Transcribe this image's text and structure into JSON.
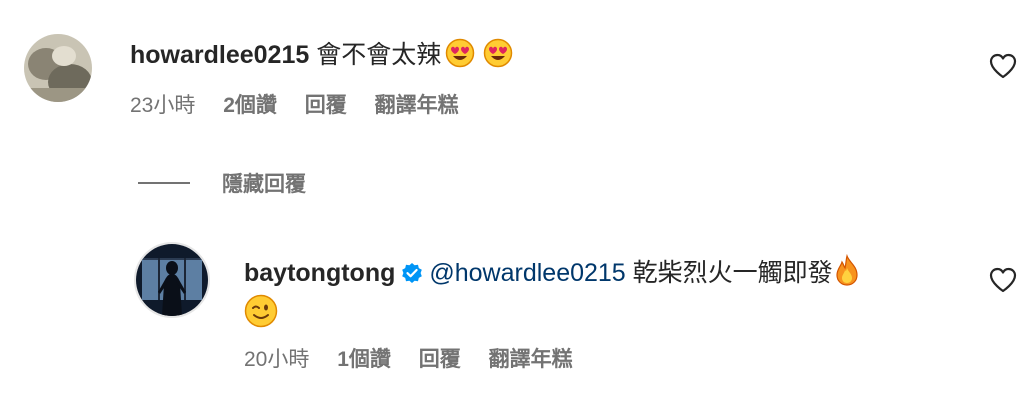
{
  "comments": [
    {
      "username": "howardlee0215",
      "text": "會不會太辣",
      "emojis": [
        "heart-eyes-emoji",
        "heart-eyes-emoji"
      ],
      "meta": {
        "time": "23小時",
        "likes": "2個讚",
        "reply": "回覆",
        "translate": "翻譯年糕"
      }
    }
  ],
  "hide_replies": "隱藏回覆",
  "reply": {
    "username": "baytongtong",
    "verified": true,
    "mention": "@howardlee0215",
    "text": "乾柴烈火一觸即發",
    "emojis": [
      "fire-emoji",
      "winking-face-emoji"
    ],
    "meta": {
      "time": "20小時",
      "likes": "1個讚",
      "reply": "回覆",
      "translate": "翻譯年糕"
    }
  },
  "colors": {
    "primary_text": "#262626",
    "secondary_text": "#737373",
    "mention": "#00376b",
    "verified_badge": "#0095f6"
  }
}
